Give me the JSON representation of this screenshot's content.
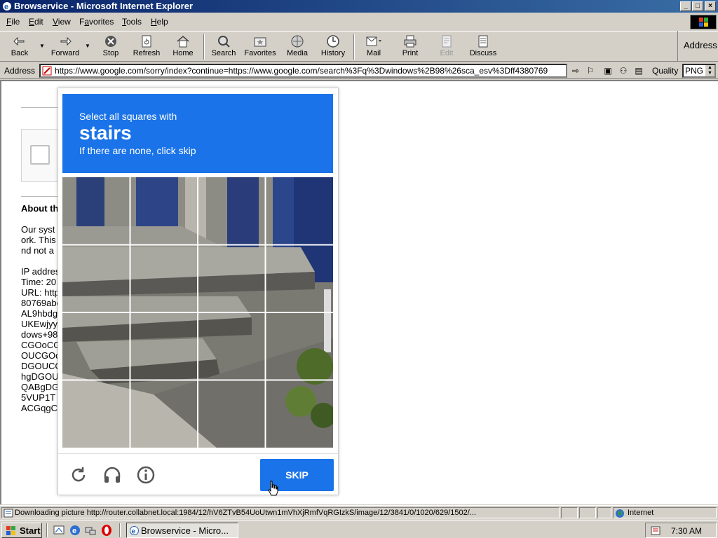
{
  "window": {
    "title": "Browservice - Microsoft Internet Explorer",
    "controls": {
      "minimize": "_",
      "maximize": "□",
      "close": "×"
    }
  },
  "menu": {
    "items": [
      {
        "pre": "",
        "u": "F",
        "post": "ile"
      },
      {
        "pre": "",
        "u": "E",
        "post": "dit"
      },
      {
        "pre": "",
        "u": "V",
        "post": "iew"
      },
      {
        "pre": "F",
        "u": "a",
        "post": "vorites"
      },
      {
        "pre": "",
        "u": "T",
        "post": "ools"
      },
      {
        "pre": "",
        "u": "H",
        "post": "elp"
      }
    ]
  },
  "toolbar": {
    "back": "Back",
    "forward": "Forward",
    "stop": "Stop",
    "refresh": "Refresh",
    "home": "Home",
    "search": "Search",
    "favorites": "Favorites",
    "media": "Media",
    "history": "History",
    "mail": "Mail",
    "print": "Print",
    "edit": "Edit",
    "discuss": "Discuss",
    "address_right": "Address"
  },
  "addressbar": {
    "label": "Address",
    "url": "https://www.google.com/sorry/index?continue=https://www.google.com/search%3Fq%3Dwindows%2B98%26sca_esv%3Dff4380769",
    "quality_label": "Quality",
    "quality_value": "PNG"
  },
  "background_page": {
    "heading": "About th",
    "para": [
      "Our syst",
      "ork. This",
      "nd not a"
    ],
    "details": [
      "IP addres",
      "Time: 20",
      "URL: http",
      "80769abe",
      "AL9hbdg",
      "UKEwjyy",
      "dows+98",
      "CGOoCG",
      "OUCGOo",
      "DGOUCC",
      "hgDGOU",
      "QABgDG",
      "5VUP1T",
      "ACGqgC"
    ]
  },
  "captcha": {
    "instruction_line1": "Select all squares with",
    "target": "stairs",
    "instruction_line3": "If there are none, click skip",
    "skip_label": "SKIP"
  },
  "statusbar": {
    "text": "Downloading picture http://router.collabnet.local:1984/12/hV6ZTvB54UoUtwn1mVhXjRmfVqRGIzkS/image/12/3841/0/1020/629/1502/...",
    "zone": "Internet"
  },
  "taskbar": {
    "start": "Start",
    "task_item": "Browservice - Micro...",
    "clock": "7:30 AM"
  },
  "colors": {
    "captcha_blue": "#1a73e8",
    "title_bar": "#0a246a",
    "chrome": "#d4d0c8"
  }
}
